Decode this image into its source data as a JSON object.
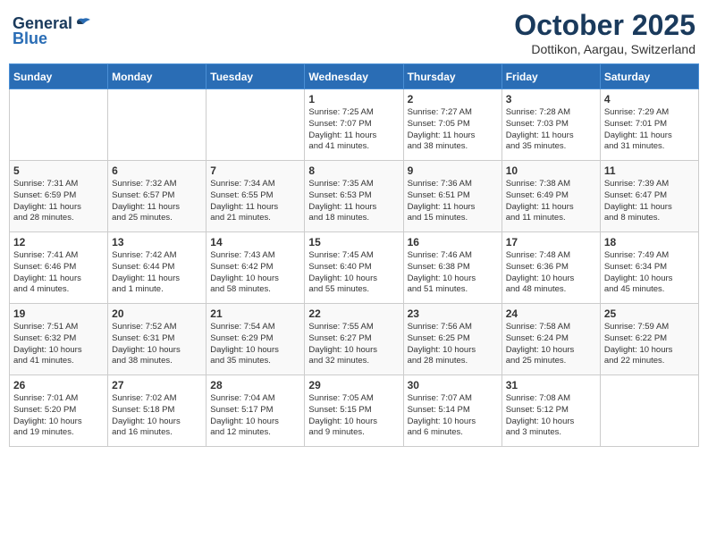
{
  "header": {
    "logo_general": "General",
    "logo_blue": "Blue",
    "month": "October 2025",
    "location": "Dottikon, Aargau, Switzerland"
  },
  "days_of_week": [
    "Sunday",
    "Monday",
    "Tuesday",
    "Wednesday",
    "Thursday",
    "Friday",
    "Saturday"
  ],
  "weeks": [
    [
      {
        "day": "",
        "info": ""
      },
      {
        "day": "",
        "info": ""
      },
      {
        "day": "",
        "info": ""
      },
      {
        "day": "1",
        "info": "Sunrise: 7:25 AM\nSunset: 7:07 PM\nDaylight: 11 hours\nand 41 minutes."
      },
      {
        "day": "2",
        "info": "Sunrise: 7:27 AM\nSunset: 7:05 PM\nDaylight: 11 hours\nand 38 minutes."
      },
      {
        "day": "3",
        "info": "Sunrise: 7:28 AM\nSunset: 7:03 PM\nDaylight: 11 hours\nand 35 minutes."
      },
      {
        "day": "4",
        "info": "Sunrise: 7:29 AM\nSunset: 7:01 PM\nDaylight: 11 hours\nand 31 minutes."
      }
    ],
    [
      {
        "day": "5",
        "info": "Sunrise: 7:31 AM\nSunset: 6:59 PM\nDaylight: 11 hours\nand 28 minutes."
      },
      {
        "day": "6",
        "info": "Sunrise: 7:32 AM\nSunset: 6:57 PM\nDaylight: 11 hours\nand 25 minutes."
      },
      {
        "day": "7",
        "info": "Sunrise: 7:34 AM\nSunset: 6:55 PM\nDaylight: 11 hours\nand 21 minutes."
      },
      {
        "day": "8",
        "info": "Sunrise: 7:35 AM\nSunset: 6:53 PM\nDaylight: 11 hours\nand 18 minutes."
      },
      {
        "day": "9",
        "info": "Sunrise: 7:36 AM\nSunset: 6:51 PM\nDaylight: 11 hours\nand 15 minutes."
      },
      {
        "day": "10",
        "info": "Sunrise: 7:38 AM\nSunset: 6:49 PM\nDaylight: 11 hours\nand 11 minutes."
      },
      {
        "day": "11",
        "info": "Sunrise: 7:39 AM\nSunset: 6:47 PM\nDaylight: 11 hours\nand 8 minutes."
      }
    ],
    [
      {
        "day": "12",
        "info": "Sunrise: 7:41 AM\nSunset: 6:46 PM\nDaylight: 11 hours\nand 4 minutes."
      },
      {
        "day": "13",
        "info": "Sunrise: 7:42 AM\nSunset: 6:44 PM\nDaylight: 11 hours\nand 1 minute."
      },
      {
        "day": "14",
        "info": "Sunrise: 7:43 AM\nSunset: 6:42 PM\nDaylight: 10 hours\nand 58 minutes."
      },
      {
        "day": "15",
        "info": "Sunrise: 7:45 AM\nSunset: 6:40 PM\nDaylight: 10 hours\nand 55 minutes."
      },
      {
        "day": "16",
        "info": "Sunrise: 7:46 AM\nSunset: 6:38 PM\nDaylight: 10 hours\nand 51 minutes."
      },
      {
        "day": "17",
        "info": "Sunrise: 7:48 AM\nSunset: 6:36 PM\nDaylight: 10 hours\nand 48 minutes."
      },
      {
        "day": "18",
        "info": "Sunrise: 7:49 AM\nSunset: 6:34 PM\nDaylight: 10 hours\nand 45 minutes."
      }
    ],
    [
      {
        "day": "19",
        "info": "Sunrise: 7:51 AM\nSunset: 6:32 PM\nDaylight: 10 hours\nand 41 minutes."
      },
      {
        "day": "20",
        "info": "Sunrise: 7:52 AM\nSunset: 6:31 PM\nDaylight: 10 hours\nand 38 minutes."
      },
      {
        "day": "21",
        "info": "Sunrise: 7:54 AM\nSunset: 6:29 PM\nDaylight: 10 hours\nand 35 minutes."
      },
      {
        "day": "22",
        "info": "Sunrise: 7:55 AM\nSunset: 6:27 PM\nDaylight: 10 hours\nand 32 minutes."
      },
      {
        "day": "23",
        "info": "Sunrise: 7:56 AM\nSunset: 6:25 PM\nDaylight: 10 hours\nand 28 minutes."
      },
      {
        "day": "24",
        "info": "Sunrise: 7:58 AM\nSunset: 6:24 PM\nDaylight: 10 hours\nand 25 minutes."
      },
      {
        "day": "25",
        "info": "Sunrise: 7:59 AM\nSunset: 6:22 PM\nDaylight: 10 hours\nand 22 minutes."
      }
    ],
    [
      {
        "day": "26",
        "info": "Sunrise: 7:01 AM\nSunset: 5:20 PM\nDaylight: 10 hours\nand 19 minutes."
      },
      {
        "day": "27",
        "info": "Sunrise: 7:02 AM\nSunset: 5:18 PM\nDaylight: 10 hours\nand 16 minutes."
      },
      {
        "day": "28",
        "info": "Sunrise: 7:04 AM\nSunset: 5:17 PM\nDaylight: 10 hours\nand 12 minutes."
      },
      {
        "day": "29",
        "info": "Sunrise: 7:05 AM\nSunset: 5:15 PM\nDaylight: 10 hours\nand 9 minutes."
      },
      {
        "day": "30",
        "info": "Sunrise: 7:07 AM\nSunset: 5:14 PM\nDaylight: 10 hours\nand 6 minutes."
      },
      {
        "day": "31",
        "info": "Sunrise: 7:08 AM\nSunset: 5:12 PM\nDaylight: 10 hours\nand 3 minutes."
      },
      {
        "day": "",
        "info": ""
      }
    ]
  ]
}
